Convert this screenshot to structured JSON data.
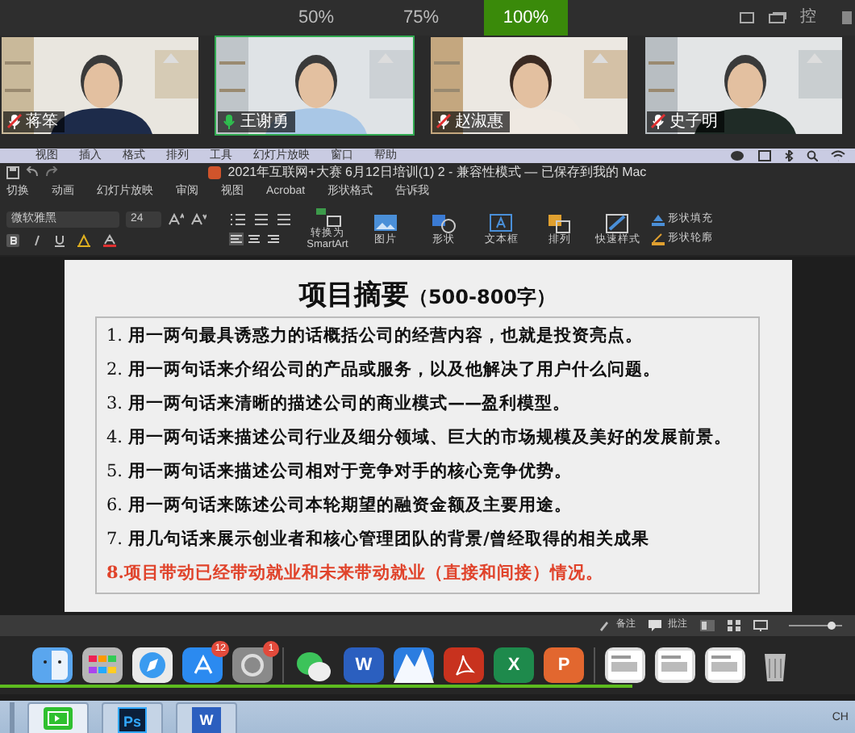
{
  "zoom_options": [
    {
      "label": "50%",
      "selected": false
    },
    {
      "label": "75%",
      "selected": false
    },
    {
      "label": "100%",
      "selected": true
    }
  ],
  "top_right_label": "控",
  "participants": [
    {
      "name": "蒋笨",
      "speaking": false
    },
    {
      "name": "王谢勇",
      "speaking": true
    },
    {
      "name": "赵淑惠",
      "speaking": false
    },
    {
      "name": "史子明",
      "speaking": false
    }
  ],
  "menu_bar": [
    "视图",
    "插入",
    "格式",
    "排列",
    "工具",
    "幻灯片放映",
    "窗口",
    "帮助"
  ],
  "document_title": "2021年互联网+大赛 6月12日培训(1) 2 - 兼容性模式 — 已保存到我的 Mac",
  "ribbon_tabs": [
    "切换",
    "动画",
    "幻灯片放映",
    "审阅",
    "视图",
    "Acrobat",
    "形状格式",
    "告诉我"
  ],
  "ribbon": {
    "font": "微软雅黑",
    "size": "24",
    "tools": [
      {
        "label": "转换为 SmartArt",
        "kind": "smartart"
      },
      {
        "label": "图片",
        "kind": "picture"
      },
      {
        "label": "形状",
        "kind": "shape"
      },
      {
        "label": "文本框",
        "kind": "textbox"
      },
      {
        "label": "排列",
        "kind": "arrange"
      },
      {
        "label": "快速样式",
        "kind": "style"
      }
    ],
    "small_tools": [
      "形状填充",
      "形状轮廓"
    ]
  },
  "slide": {
    "title": "项目摘要",
    "subtitle": "（500-800字）",
    "items": [
      {
        "number": "1.",
        "text": "用一两句最具诱惑力的话概括公司的经营内容，也就是投资亮点。",
        "highlight": false
      },
      {
        "number": "2.",
        "text": "用一两句话来介绍公司的产品或服务，以及他解决了用户什么问题。",
        "highlight": false
      },
      {
        "number": "3.",
        "text": "用一两句话来清晰的描述公司的商业模式——盈利模型。",
        "highlight": false
      },
      {
        "number": "4.",
        "text": "用一两句话来描述公司行业及细分领域、巨大的市场规模及美好的发展前景。",
        "highlight": false
      },
      {
        "number": "5.",
        "text": "用一两句话来描述公司相对于竞争对手的核心竞争优势。",
        "highlight": false
      },
      {
        "number": "6.",
        "text": "用一两句话来陈述公司本轮期望的融资金额及主要用途。",
        "highlight": false
      },
      {
        "number": "7.",
        "text": "用几句话来展示创业者和核心管理团队的背景/曾经取得的相关成果",
        "highlight": false
      },
      {
        "number": "8.",
        "text": "项目带动已经带动就业和未来带动就业（直接和间接）情况。",
        "highlight": true
      }
    ]
  },
  "status_bar": {
    "notes": "备注",
    "comments": "批注"
  },
  "dock": [
    {
      "kind": "finder"
    },
    {
      "kind": "launchpad"
    },
    {
      "kind": "safari"
    },
    {
      "kind": "appstore",
      "badge": "12"
    },
    {
      "kind": "settings",
      "badge": "1"
    },
    {
      "kind": "wechat"
    },
    {
      "kind": "word",
      "glyph": "W"
    },
    {
      "kind": "mountains"
    },
    {
      "kind": "acrobat"
    },
    {
      "kind": "excel",
      "glyph": "X"
    },
    {
      "kind": "powerpoint",
      "glyph": "P"
    },
    {
      "kind": "thumbnail"
    },
    {
      "kind": "thumbnail"
    },
    {
      "kind": "thumbnail"
    },
    {
      "kind": "trash"
    }
  ],
  "share_progress": {
    "level": 0.74
  },
  "zoom_slider": {
    "level": 0.8
  },
  "taskbar": {
    "apps": [
      {
        "kind": "meeting",
        "active": true
      },
      {
        "kind": "photoshop",
        "glyph": "Ps",
        "active": false
      },
      {
        "kind": "word",
        "glyph": "W",
        "active": false
      }
    ],
    "language": "CH"
  }
}
